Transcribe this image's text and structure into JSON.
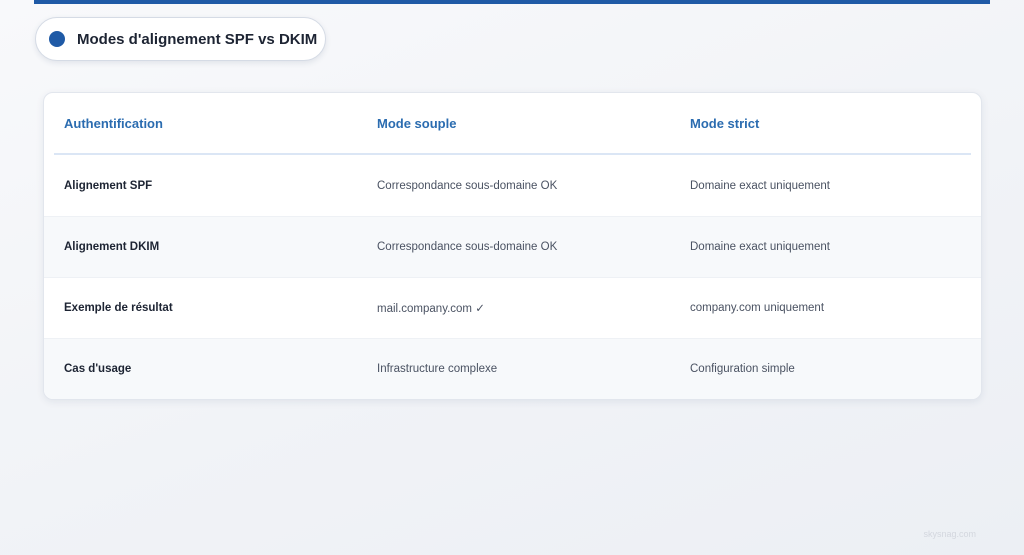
{
  "title": "Modes d'alignement SPF vs DKIM",
  "table": {
    "headers": [
      "Authentification",
      "Mode souple",
      "Mode strict"
    ],
    "rows": [
      [
        "Alignement SPF",
        "Correspondance sous-domaine OK",
        "Domaine exact uniquement"
      ],
      [
        "Alignement DKIM",
        "Correspondance sous-domaine OK",
        "Domaine exact uniquement"
      ],
      [
        "Exemple de résultat",
        "mail.company.com ✓",
        "company.com uniquement"
      ],
      [
        "Cas d'usage",
        "Infrastructure complexe",
        "Configuration simple"
      ]
    ]
  },
  "watermark": "skysnag.com",
  "colors": {
    "accent": "#1f5aa6",
    "header_text": "#2b6cb0",
    "body_text": "#4a5262",
    "label_text": "#1d2433"
  }
}
